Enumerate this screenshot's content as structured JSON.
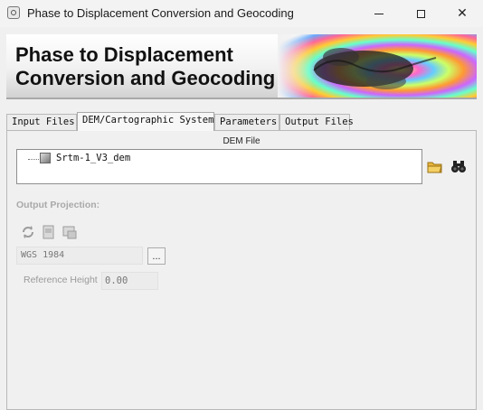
{
  "window": {
    "title": "Phase to Displacement Conversion and Geocoding"
  },
  "banner": {
    "title": "Phase to Displacement\nConversion and Geocoding"
  },
  "tabs": [
    {
      "label": "Input Files"
    },
    {
      "label": "DEM/Cartographic System"
    },
    {
      "label": "Parameters"
    },
    {
      "label": "Output Files"
    }
  ],
  "dem": {
    "section_label": "DEM File",
    "tree_item": "Srtm-1_V3_dem"
  },
  "projection": {
    "label": "Output Projection:",
    "value": "WGS 1984",
    "browse_label": "...",
    "reference_height_label": "Reference Height",
    "reference_height_value": "0.00"
  },
  "colors": {
    "disabled_text": "#a9a9a9",
    "window_bg": "#f0f0f0"
  }
}
